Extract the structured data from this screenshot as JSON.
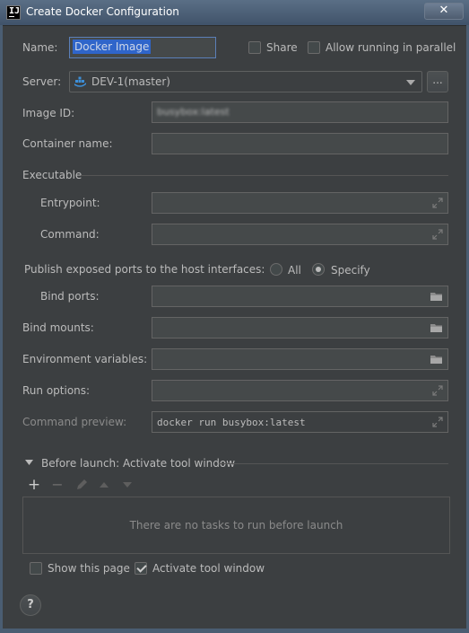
{
  "window": {
    "title": "Create Docker Configuration",
    "close_glyph": "✕",
    "app_icon_letters": "IJ"
  },
  "form": {
    "name_label": "Name:",
    "name_value": "Docker Image",
    "share_label": "Share",
    "share_checked": false,
    "parallel_label": "Allow running in parallel",
    "parallel_checked": false,
    "server_label": "Server:",
    "server_value": "DEV-1(master)",
    "server_browse": "...",
    "image_id_label": "Image ID:",
    "image_id_value": "busybox:latest",
    "container_name_label": "Container name:",
    "container_name_value": ""
  },
  "executable": {
    "section_label": "Executable",
    "entrypoint_label": "Entrypoint:",
    "entrypoint_value": "",
    "command_label": "Command:",
    "command_value": ""
  },
  "ports": {
    "publish_label": "Publish exposed ports to the host interfaces:",
    "all_label": "All",
    "specify_label": "Specify",
    "selected": "Specify",
    "bind_ports_label": "Bind ports:"
  },
  "more": {
    "bind_mounts_label": "Bind mounts:",
    "env_label": "Environment variables:",
    "run_options_label": "Run options:",
    "preview_label": "Command preview:",
    "preview_value": "docker run busybox:latest"
  },
  "before_launch": {
    "header": "Before launch: Activate tool window",
    "add": "+",
    "remove": "−",
    "empty_message": "There are no tasks to run before launch",
    "show_page_label": "Show this page",
    "show_page_checked": false,
    "activate_label": "Activate tool window",
    "activate_checked": true
  },
  "help": {
    "glyph": "?"
  },
  "icons": [
    "app-icon",
    "close-icon",
    "server-icon",
    "expand-icon",
    "folder-icon",
    "triangle-down-icon",
    "add-icon",
    "remove-icon",
    "edit-icon",
    "move-up-icon",
    "move-down-icon",
    "help-icon"
  ]
}
